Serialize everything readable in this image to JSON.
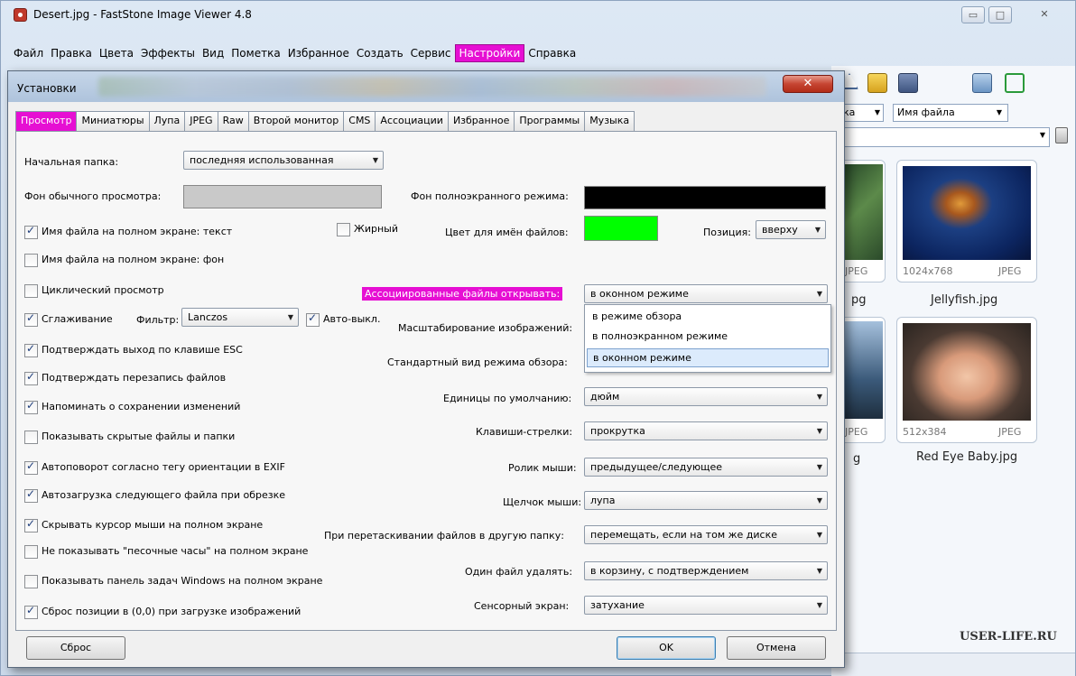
{
  "window": {
    "title": "Desert.jpg  -  FastStone Image Viewer 4.8",
    "min_label": "▭",
    "max_label": "□",
    "close_label": "✕"
  },
  "menu": [
    {
      "label": "Файл",
      "highlighted": false
    },
    {
      "label": "Правка",
      "highlighted": false
    },
    {
      "label": "Цвета",
      "highlighted": false
    },
    {
      "label": "Эффекты",
      "highlighted": false
    },
    {
      "label": "Вид",
      "highlighted": false
    },
    {
      "label": "Пометка",
      "highlighted": false
    },
    {
      "label": "Избранное",
      "highlighted": false
    },
    {
      "label": "Создать",
      "highlighted": false
    },
    {
      "label": "Сервис",
      "highlighted": false
    },
    {
      "label": "Настройки",
      "highlighted": true
    },
    {
      "label": "Справка",
      "highlighted": false
    }
  ],
  "browser": {
    "sort_value": "ка",
    "filename_sort": "Имя файла",
    "thumbs": [
      {
        "name": "",
        "size": "",
        "format": "JPEG"
      },
      {
        "name": "Jellyfish.jpg",
        "size": "1024x768",
        "format": "JPEG"
      },
      {
        "name": "",
        "size": "",
        "format": "JPEG"
      },
      {
        "name": "Red Eye Baby.jpg",
        "size": "512x384",
        "format": "JPEG"
      }
    ],
    "partial_name_1": "pg",
    "partial_name_2": "g",
    "watermark": "USER-LIFE.RU"
  },
  "dialog": {
    "title": "Установки",
    "close_label": "✕",
    "tabs": [
      {
        "label": "Просмотр",
        "active": true
      },
      {
        "label": "Миниатюры",
        "active": false
      },
      {
        "label": "Лупа",
        "active": false
      },
      {
        "label": "JPEG",
        "active": false
      },
      {
        "label": "Raw",
        "active": false
      },
      {
        "label": "Второй монитор",
        "active": false
      },
      {
        "label": "CMS",
        "active": false
      },
      {
        "label": "Ассоциации",
        "active": false
      },
      {
        "label": "Избранное",
        "active": false
      },
      {
        "label": "Программы",
        "active": false
      },
      {
        "label": "Музыка",
        "active": false
      }
    ],
    "start_folder_label": "Начальная папка:",
    "start_folder_value": "последняя использованная",
    "normal_bg_label": "Фон обычного просмотра:",
    "normal_bg_color": "#c9c9c9",
    "fullscreen_bg_label": "Фон полноэкранного режима:",
    "fullscreen_bg_color": "#000000",
    "filename_text_label": "Имя файла на полном экране: текст",
    "bold_label": "Жирный",
    "filename_color_label": "Цвет для имён файлов:",
    "filename_color": "#00ff00",
    "position_label": "Позиция:",
    "position_value": "вверху",
    "filename_bg_label": "Имя файла на полном экране: фон",
    "cyclic_label": "Циклический просмотр",
    "assoc_open_label": "Ассоциированные файлы открывать:",
    "assoc_open_value": "в оконном режиме",
    "assoc_options": [
      "в режиме обзора",
      "в полноэкранном режиме",
      "в оконном режиме"
    ],
    "smoothing_label": "Сглаживание",
    "filter_label": "Фильтр:",
    "filter_value": "Lanczos",
    "auto_off_label": "Авто-выкл.",
    "scaling_label": "Масштабирование изображений:",
    "confirm_esc_label": "Подтверждать выход по клавише ESC",
    "default_view_label": "Стандартный вид режима обзора:",
    "confirm_overwrite_label": "Подтверждать перезапись файлов",
    "remind_save_label": "Напоминать о сохранении изменений",
    "units_label": "Единицы по умолчанию:",
    "units_value": "дюйм",
    "show_hidden_label": "Показывать скрытые файлы и папки",
    "arrows_label": "Клавиши-стрелки:",
    "arrows_value": "прокрутка",
    "autorotate_label": "Автоповорот согласно тегу ориентации в EXIF",
    "wheel_label": "Ролик мыши:",
    "wheel_value": "предыдущее/следующее",
    "autoload_label": "Автозагрузка следующего файла при обрезке",
    "click_label": "Щелчок мыши:",
    "click_value": "лупа",
    "hide_cursor_label": "Скрывать курсор мыши на полном экране",
    "drag_label": "При перетаскивании файлов в другую папку:",
    "drag_value": "перемещать, если на том же диске",
    "no_hourglass_label": "Не показывать \"песочные часы\" на полном экране",
    "delete_label": "Один файл удалять:",
    "delete_value": "в корзину, с подтверждением",
    "taskbar_label": "Показывать панель задач Windows на полном экране",
    "touch_label": "Сенсорный экран:",
    "touch_value": "затухание",
    "reset_pos_label": "Сброс позиции в (0,0) при загрузке изображений",
    "reset_button": "Сброс",
    "ok_button": "OK",
    "cancel_button": "Отмена"
  },
  "colors": {
    "highlight": "#e60fd3"
  }
}
